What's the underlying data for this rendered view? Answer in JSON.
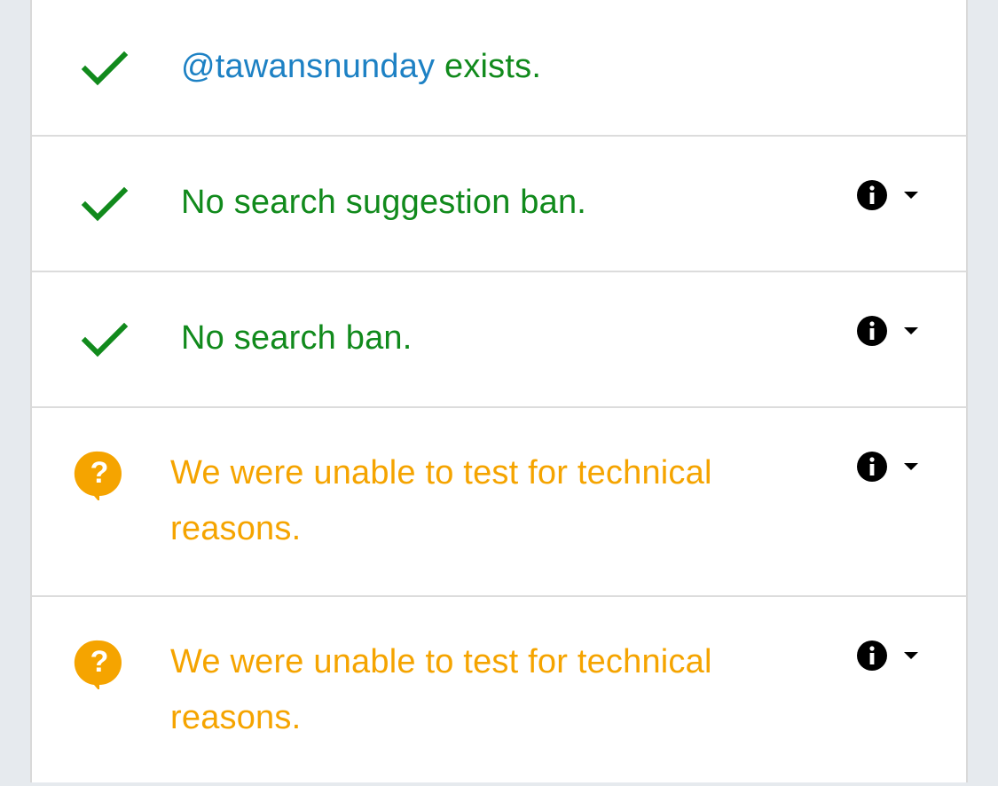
{
  "rows": [
    {
      "status": "ok",
      "icon": "checkmark-icon",
      "handle": "@tawansnunday",
      "text": " exists.",
      "has_controls": false
    },
    {
      "status": "ok",
      "icon": "checkmark-icon",
      "text": "No search suggestion ban.",
      "has_controls": true
    },
    {
      "status": "ok",
      "icon": "checkmark-icon",
      "text": "No search ban.",
      "has_controls": true
    },
    {
      "status": "warn",
      "icon": "question-bubble-icon",
      "text": "We were unable to test for technical reasons.",
      "has_controls": true
    },
    {
      "status": "warn",
      "icon": "question-bubble-icon",
      "text": "We were unable to test for technical reasons.",
      "has_controls": true
    }
  ],
  "controls": {
    "info_icon": "info-icon",
    "expand_icon": "caret-down-icon"
  },
  "colors": {
    "ok": "#118a1c",
    "warn": "#f5a400",
    "handle": "#1d81c4",
    "background": "#e6eaee",
    "panel": "#ffffff"
  }
}
